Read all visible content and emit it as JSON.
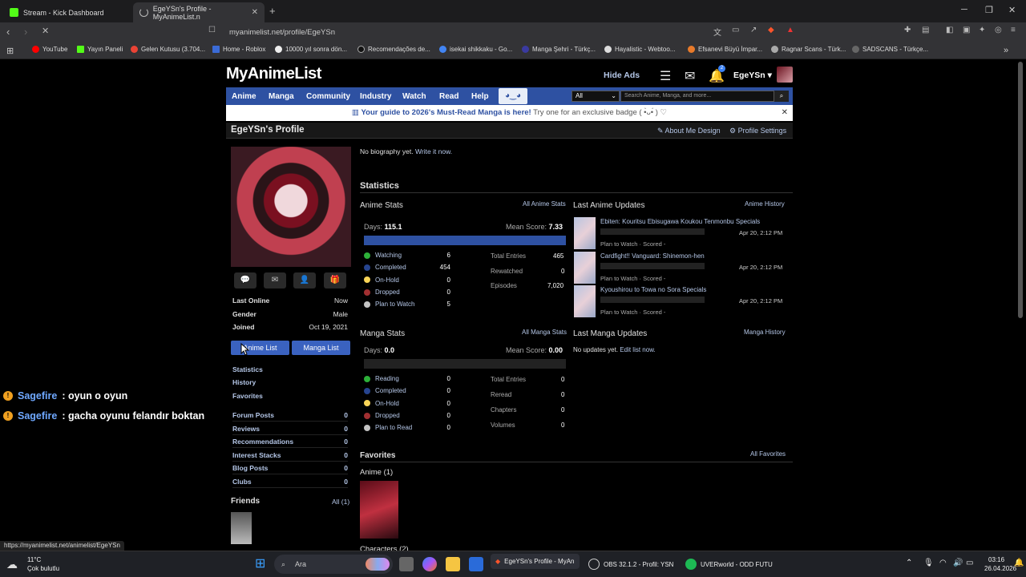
{
  "browser": {
    "tabs": [
      {
        "label": "Stream - Kick Dashboard",
        "active": false
      },
      {
        "label": "EgeYSn's Profile - MyAnimeList.n",
        "active": true
      }
    ],
    "url": "myanimelist.net/profile/EgeYSn",
    "bookmarks": [
      "YouTube",
      "Yayın Paneli",
      "Gelen Kutusu (3.704...",
      "Home - Roblox",
      "10000 yıl sonra dön...",
      "Recomendações de...",
      "isekai shikkaku - Go...",
      "Manga Şehri - Türkç...",
      "Hayalistic - Webtoo...",
      "Efsanevi Büyü İmpar...",
      "Ragnar Scans - Türk...",
      "SADSCANS - Türkçe..."
    ]
  },
  "header": {
    "logo": "MyAnimeList",
    "hide_ads": "Hide Ads",
    "username": "EgeYSn ▾",
    "notif_count": "2"
  },
  "nav": {
    "items": [
      "Anime",
      "Manga",
      "Community",
      "Industry",
      "Watch",
      "Read",
      "Help"
    ],
    "select": "All",
    "search_placeholder": "Search Anime, Manga, and more..."
  },
  "banner": {
    "bold": "Your guide to 2026's Must-Read Manga is here!",
    "rest": " Try one for an exclusive badge ( •̀ᴗ•́ ) ♡"
  },
  "profile": {
    "title": "EgeYSn's Profile",
    "about_me_design": "About Me Design",
    "settings": "Profile Settings",
    "bio_prefix": "No biography yet.",
    "bio_link": "Write it now.",
    "info": [
      {
        "k": "Last Online",
        "v": "Now"
      },
      {
        "k": "Gender",
        "v": "Male"
      },
      {
        "k": "Joined",
        "v": "Oct 19, 2021"
      }
    ],
    "anime_list": "Anime List",
    "manga_list": "Manga List",
    "side_links": [
      "Statistics",
      "History",
      "Favorites"
    ],
    "counts": [
      {
        "k": "Forum Posts",
        "v": "0"
      },
      {
        "k": "Reviews",
        "v": "0"
      },
      {
        "k": "Recommendations",
        "v": "0"
      },
      {
        "k": "Interest Stacks",
        "v": "0"
      },
      {
        "k": "Blog Posts",
        "v": "0"
      },
      {
        "k": "Clubs",
        "v": "0"
      }
    ],
    "friends": "Friends",
    "friends_all": "All (1)"
  },
  "stats": {
    "heading": "Statistics",
    "anime": {
      "title": "Anime Stats",
      "all_link": "All Anime Stats",
      "days_label": "Days:",
      "days": "115.1",
      "mean_label": "Mean Score:",
      "mean": "7.33",
      "progress": 1.0,
      "rows": [
        {
          "label": "Watching",
          "v": "6",
          "color": "#2db039"
        },
        {
          "label": "Completed",
          "v": "454",
          "color": "#26448f"
        },
        {
          "label": "On-Hold",
          "v": "0",
          "color": "#f9d457"
        },
        {
          "label": "Dropped",
          "v": "0",
          "color": "#a12f31"
        },
        {
          "label": "Plan to Watch",
          "v": "5",
          "color": "#c3c3c3"
        }
      ],
      "totals": [
        {
          "k": "Total Entries",
          "v": "465"
        },
        {
          "k": "Rewatched",
          "v": "0"
        },
        {
          "k": "Episodes",
          "v": "7,020"
        }
      ]
    },
    "manga": {
      "title": "Manga Stats",
      "all_link": "All Manga Stats",
      "days_label": "Days:",
      "days": "0.0",
      "mean_label": "Mean Score:",
      "mean": "0.00",
      "rows": [
        {
          "label": "Reading",
          "v": "0",
          "color": "#2db039"
        },
        {
          "label": "Completed",
          "v": "0",
          "color": "#26448f"
        },
        {
          "label": "On-Hold",
          "v": "0",
          "color": "#f9d457"
        },
        {
          "label": "Dropped",
          "v": "0",
          "color": "#a12f31"
        },
        {
          "label": "Plan to Read",
          "v": "0",
          "color": "#c3c3c3"
        }
      ],
      "totals": [
        {
          "k": "Total Entries",
          "v": "0"
        },
        {
          "k": "Reread",
          "v": "0"
        },
        {
          "k": "Chapters",
          "v": "0"
        },
        {
          "k": "Volumes",
          "v": "0"
        }
      ]
    }
  },
  "updates": {
    "anime_title": "Last Anime Updates",
    "anime_history": "Anime History",
    "items": [
      {
        "title": "Ebiten: Kouritsu Ebisugawa Koukou Tenmonbu Specials",
        "date": "Apr 20, 2:12 PM",
        "status": "Plan to Watch · Scored -"
      },
      {
        "title": "Cardfight!! Vanguard: Shinemon-hen",
        "date": "Apr 20, 2:12 PM",
        "status": "Plan to Watch · Scored -"
      },
      {
        "title": "Kyoushirou to Towa no Sora Specials",
        "date": "Apr 20, 2:12 PM",
        "status": "Plan to Watch · Scored -"
      }
    ],
    "manga_title": "Last Manga Updates",
    "manga_history": "Manga History",
    "manga_empty": "No updates yet.",
    "manga_edit": "Edit list now."
  },
  "favorites": {
    "title": "Favorites",
    "all": "All Favorites",
    "anime": "Anime (1)",
    "characters": "Characters (2)"
  },
  "chat": [
    {
      "name": "Sagefire",
      "msg": ": oyun o oyun"
    },
    {
      "name": "Sagefire",
      "msg": ": gacha oyunu felandır boktan"
    }
  ],
  "status_url": "https://myanimelist.net/animelist/EgeYSn",
  "taskbar": {
    "weather_temp": "11°C",
    "weather_desc": "Çok bulutlu",
    "search": "Ara",
    "apps": [
      "EgeYSn's Profile - MyAn",
      "OBS 32.1.2 - Profil: YSN",
      "UVERworld - ODD FUTU"
    ],
    "time": "03:16",
    "date": "26.04.2026"
  }
}
